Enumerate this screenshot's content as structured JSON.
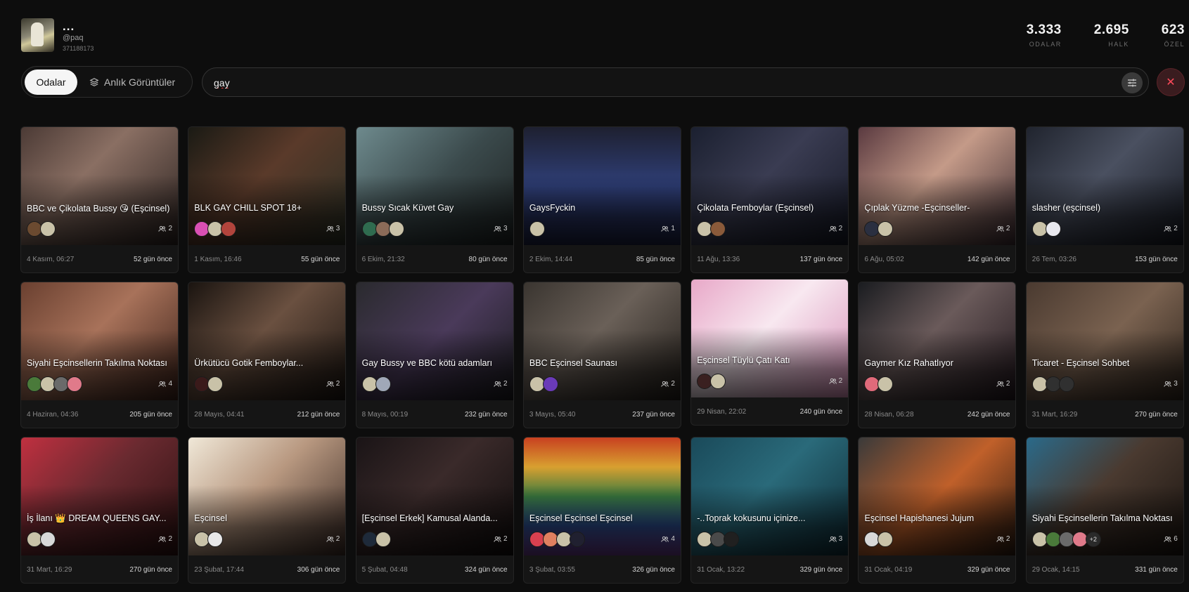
{
  "profile": {
    "name": "...",
    "handle": "@paq",
    "id": "371188173"
  },
  "stats": [
    {
      "value": "3.333",
      "label": "ODALAR"
    },
    {
      "value": "2.695",
      "label": "HALK"
    },
    {
      "value": "623",
      "label": "ÖZEL"
    }
  ],
  "tabs": {
    "rooms": "Odalar",
    "snapshots": "Anlık Görüntüler"
  },
  "search": {
    "value": "gay"
  },
  "colors": {
    "background": "#0d0d0d",
    "accent_close": "#ff4a5a"
  },
  "rooms": [
    {
      "title": "BBC ve Çikolata Bussy 😘 (Eşcinsel)",
      "members": "2",
      "date": "4 Kasım, 06:27",
      "ago": "52 gün önce",
      "bg": "linear-gradient(135deg,#4b3a35,#8a6f63 40%,#2b2220)",
      "avatars": [
        "#6b4a30",
        "#c9c2a8"
      ]
    },
    {
      "title": "BLK GAY CHILL SPOT 18+",
      "members": "3",
      "date": "1 Kasım, 16:46",
      "ago": "55 gün önce",
      "bg": "linear-gradient(135deg,#1a1a14,#5a3a2a 45%,#2a2f24)",
      "avatars": [
        "#d94fb3",
        "#c9c2a8",
        "#b2443c"
      ]
    },
    {
      "title": "Bussy Sıcak Küvet Gay",
      "members": "3",
      "date": "6 Ekim, 21:32",
      "ago": "80 gün önce",
      "bg": "linear-gradient(135deg,#6e8a8d,#3b4a4c 50%,#1d2222)",
      "avatars": [
        "#2f6b4f",
        "#8b6b58",
        "#c9c2a8"
      ]
    },
    {
      "title": "GaysFyckin",
      "members": "1",
      "date": "2 Ekim, 14:44",
      "ago": "85 gün önce",
      "bg": "linear-gradient(180deg,#1e2030,#2f3f78 50%,#1b2040)",
      "avatars": [
        "#c9c2a8"
      ]
    },
    {
      "title": "Çikolata Femboylar (Eşcinsel)",
      "members": "2",
      "date": "11 Ağu, 13:36",
      "ago": "137 gün önce",
      "bg": "linear-gradient(135deg,#1b2030,#3a3c52 45%,#151825)",
      "avatars": [
        "#c9c2a8",
        "#8a5a3a"
      ]
    },
    {
      "title": "Çıplak Yüzme -Eşcinseller-",
      "members": "2",
      "date": "6 Ağu, 05:02",
      "ago": "142 gün önce",
      "bg": "linear-gradient(135deg,#5a3a40,#c49a88 45%,#3a2a30)",
      "avatars": [
        "#2a2f40",
        "#c9c2a8"
      ]
    },
    {
      "title": "slasher (eşcinsel)",
      "members": "2",
      "date": "26 Tem, 03:26",
      "ago": "153 gün önce",
      "bg": "linear-gradient(135deg,#20242e,#4a5060 45%,#151820)",
      "avatars": [
        "#c9c2a8",
        "#e8e8ee"
      ]
    },
    {
      "title": "Siyahi Eşcinsellerin Takılma Noktası",
      "members": "4",
      "date": "4 Haziran, 04:36",
      "ago": "205 gün önce",
      "bg": "linear-gradient(135deg,#6a4030,#a8725a 45%,#3a2018)",
      "avatars": [
        "#4a7a3a",
        "#c9c2a8",
        "#6a6a6a",
        "#e07a8a"
      ]
    },
    {
      "title": "Ürkütücü Gotik Femboylar...",
      "members": "2",
      "date": "28 Mayıs, 04:41",
      "ago": "212 gün önce",
      "bg": "linear-gradient(135deg,#1a1410,#6a5040 45%,#1a1410)",
      "avatars": [
        "#3a1a1a",
        "#c9c2a8"
      ]
    },
    {
      "title": "Gay Bussy ve BBC kötü adamları",
      "members": "2",
      "date": "8 Mayıs, 00:19",
      "ago": "232 gün önce",
      "bg": "linear-gradient(135deg,#2a2a2e,#4a3a5a 50%,#1a1a1e)",
      "avatars": [
        "#c9c2a8",
        "#a0a8b8"
      ]
    },
    {
      "title": "BBC Eşcinsel Saunası",
      "members": "2",
      "date": "3 Mayıs, 05:40",
      "ago": "237 gün önce",
      "bg": "linear-gradient(135deg,#3a3530,#6a6058 45%,#201c18)",
      "avatars": [
        "#c9c2a8",
        "#6a3ab8"
      ]
    },
    {
      "title": "Eşcinsel Tüylü Çatı Katı",
      "members": "2",
      "date": "29 Nisan, 22:02",
      "ago": "240 gün önce",
      "bg": "linear-gradient(135deg,#e8a8c8,#f8e8f0 45%,#d890b8)",
      "avatars": [
        "#3a2020",
        "#c9c2a8"
      ]
    },
    {
      "title": "Gaymer Kız Rahatlıyor",
      "members": "2",
      "date": "28 Nisan, 06:28",
      "ago": "242 gün önce",
      "bg": "linear-gradient(135deg,#1a1c20,#6a5a5a 45%,#20161c)",
      "avatars": [
        "#e06a7a",
        "#c9c2a8"
      ]
    },
    {
      "title": "Ticaret - Eşcinsel Sohbet",
      "members": "3",
      "date": "31 Mart, 16:29",
      "ago": "270 gün önce",
      "bg": "linear-gradient(135deg,#4a3a30,#7a6250 50%,#2e241c)",
      "avatars": [
        "#c9c2a8",
        "#303030",
        "#303030"
      ]
    },
    {
      "title": "İş İlanı 👑 DREAM QUEENS GAY...",
      "members": "2",
      "date": "31 Mart, 16:29",
      "ago": "270 gün önce",
      "bg": "linear-gradient(135deg,#c03040,#6a2a30 45%,#2a1010)",
      "avatars": [
        "#c9c2a8",
        "#d8d8d8"
      ]
    },
    {
      "title": "Eşcinsel",
      "members": "2",
      "date": "23 Şubat, 17:44",
      "ago": "306 gün önce",
      "bg": "linear-gradient(135deg,#f0e8d8,#b89880 45%,#3a2a24)",
      "avatars": [
        "#c9c2a8",
        "#e8e8e8"
      ]
    },
    {
      "title": "[Eşcinsel Erkek] Kamusal Alanda...",
      "members": "2",
      "date": "5 Şubat, 04:48",
      "ago": "324 gün önce",
      "bg": "linear-gradient(135deg,#1a1416,#3a2a2a 45%,#100c0c)",
      "avatars": [
        "#1e2a3a",
        "#c9c2a8"
      ]
    },
    {
      "title": "Eşcinsel Eşcinsel Eşcinsel",
      "members": "4",
      "date": "3 Şubat, 03:55",
      "ago": "326 gün önce",
      "bg": "linear-gradient(180deg,#c84020,#d8a030 25%,#3a7a40 50%,#2a4a8a 75%,#6a3a8a)",
      "avatars": [
        "#d84050",
        "#e08060",
        "#c9c2a8",
        "#202030"
      ]
    },
    {
      "title": "-..Toprak kokusunu içinize...",
      "members": "3",
      "date": "31 Ocak, 13:22",
      "ago": "329 gün önce",
      "bg": "linear-gradient(135deg,#1a4a5a,#2a6a7a 45%,#0e2a34)",
      "avatars": [
        "#c9c2a8",
        "#4a4a4a",
        "#202020"
      ]
    },
    {
      "title": "Eşcinsel Hapishanesi Jujum",
      "members": "2",
      "date": "31 Ocak, 04:19",
      "ago": "329 gün önce",
      "bg": "linear-gradient(135deg,#3a3a3a,#c0602a 50%,#2a1a10)",
      "avatars": [
        "#d8d8d8",
        "#c9c2a8"
      ]
    },
    {
      "title": "Siyahi Eşcinsellerin Takılma Noktası",
      "members": "6",
      "date": "29 Ocak, 14:15",
      "ago": "331 gün önce",
      "bg": "linear-gradient(135deg,#2a6a8a,#4a3a30 45%,#1a1410)",
      "avatars": [
        "#c9c2a8",
        "#4a7a3a",
        "#6a6a6a",
        "#e07a8a"
      ],
      "more": "+2"
    }
  ]
}
